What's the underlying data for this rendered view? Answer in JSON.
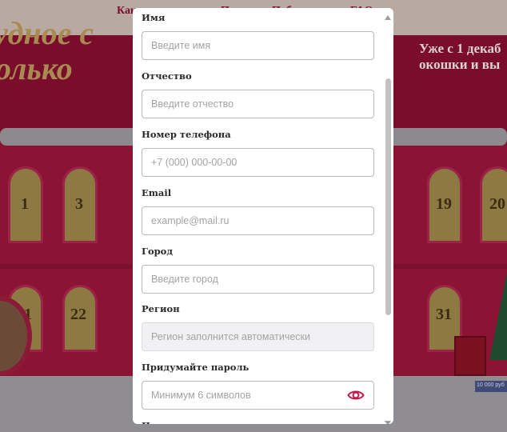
{
  "background": {
    "nav": [
      "Как",
      "П",
      "Поб",
      "FAQ"
    ],
    "heading_line1": "удное с",
    "heading_line2": "олько",
    "promo_line1": "Уже с 1 декаб",
    "promo_line2": "окошки и вы",
    "windows": [
      "1",
      "3",
      "19",
      "20",
      "21",
      "22",
      "31"
    ],
    "badge_text": "10 000 руб"
  },
  "form": {
    "fields": [
      {
        "label": "Имя",
        "placeholder": "Введите имя"
      },
      {
        "label": "Отчество",
        "placeholder": "Введите отчество"
      },
      {
        "label": "Номер телефона",
        "placeholder": "+7 (000) 000-00-00"
      },
      {
        "label": "Email",
        "placeholder": "example@mail.ru"
      },
      {
        "label": "Город",
        "placeholder": "Введите город"
      },
      {
        "label": "Регион",
        "placeholder": "Регион заполнится автоматически"
      },
      {
        "label": "Придумайте пароль",
        "placeholder": "Минимум 6 символов"
      }
    ],
    "next_label_partial": "П"
  },
  "colors": {
    "accent": "#c8144a",
    "backdrop": "#7f0d2c",
    "input_border": "#b9b9b9",
    "disabled_bg": "#f1f1f3"
  },
  "icons": {
    "password_toggle": "eye-icon",
    "scroll_up": "triangle-up-icon",
    "scroll_down": "triangle-down-icon"
  }
}
